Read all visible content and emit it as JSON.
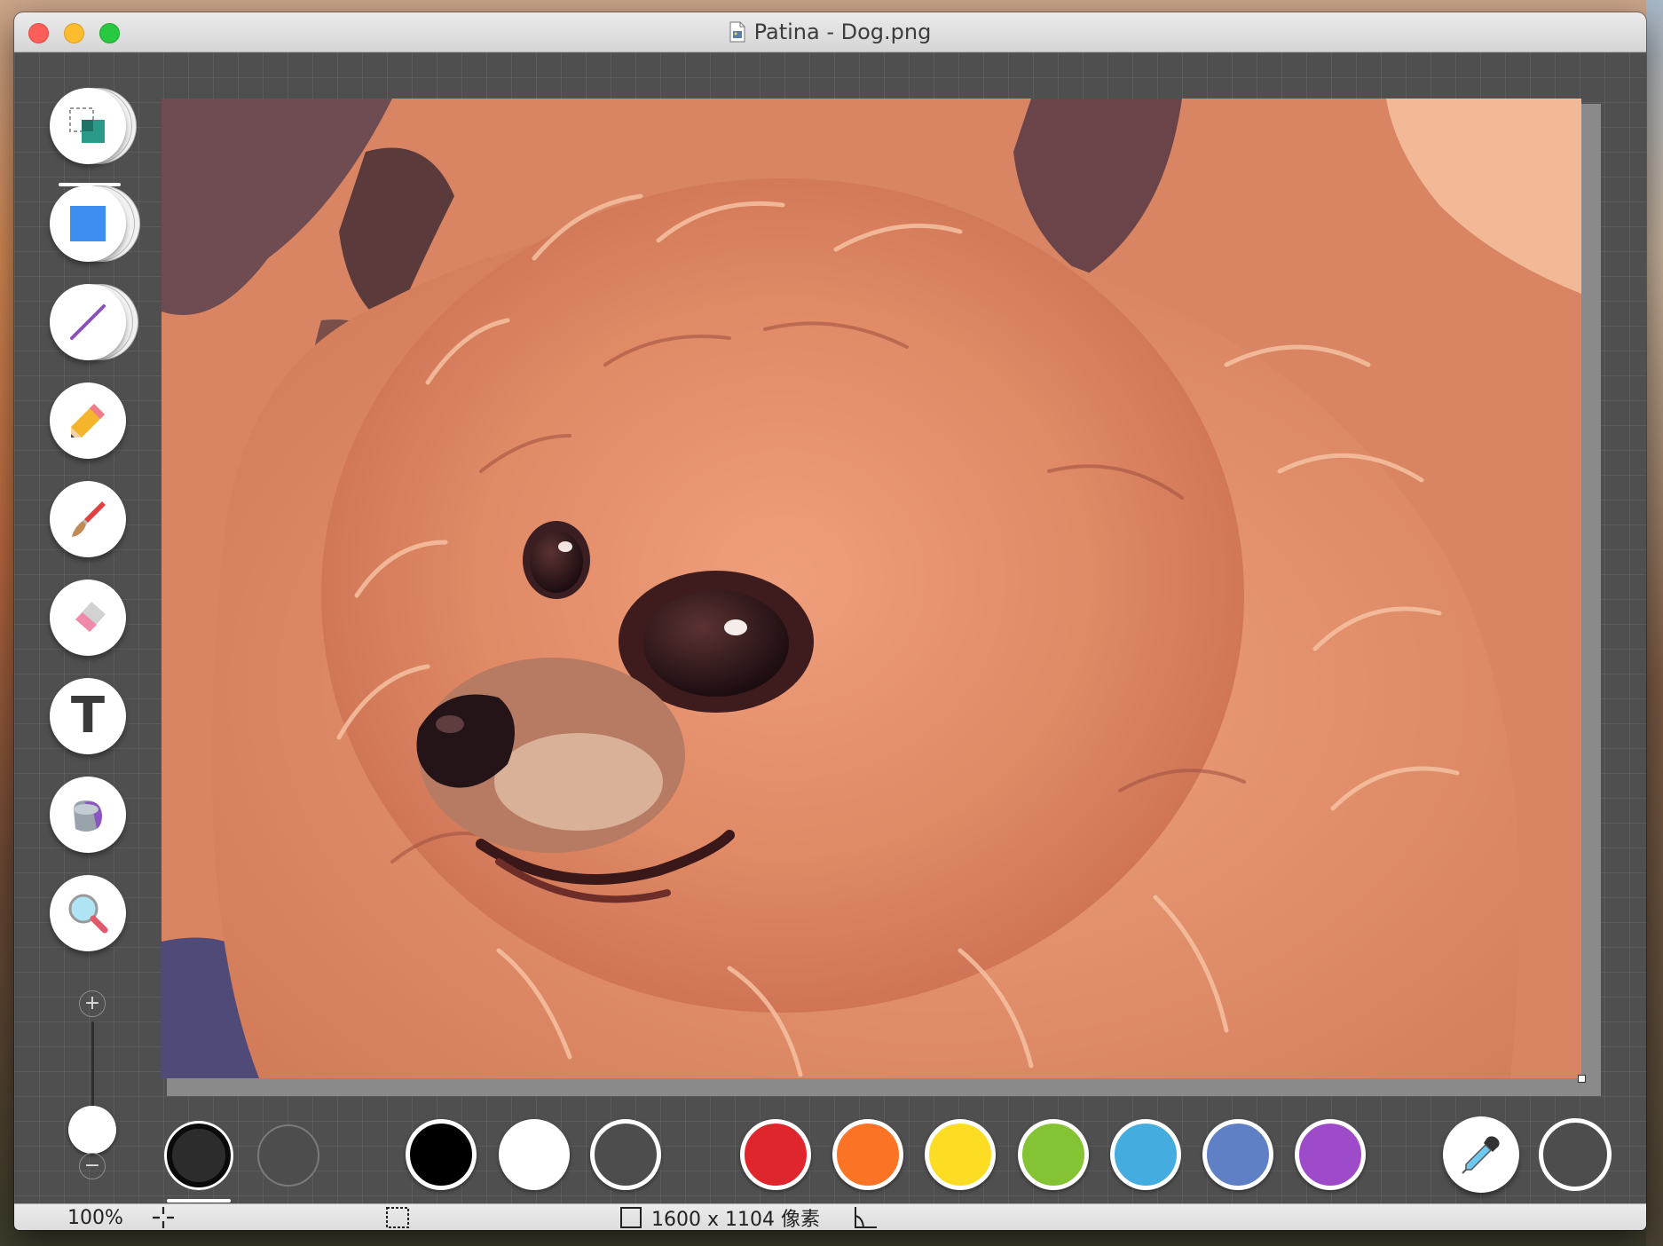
{
  "window": {
    "title": "Patina - Dog.png",
    "file_icon": "document-icon"
  },
  "toolbar": {
    "tools": [
      {
        "id": "select",
        "icon": "selection-icon"
      },
      {
        "id": "shape",
        "icon": "square-shape-icon"
      },
      {
        "id": "line",
        "icon": "line-icon"
      },
      {
        "id": "pencil",
        "icon": "pencil-icon"
      },
      {
        "id": "brush",
        "icon": "brush-icon"
      },
      {
        "id": "eraser",
        "icon": "eraser-icon"
      },
      {
        "id": "text",
        "icon": "text-icon",
        "label": "T"
      },
      {
        "id": "fill",
        "icon": "paint-bucket-icon"
      },
      {
        "id": "magnifier",
        "icon": "magnifier-icon"
      }
    ],
    "selected_tool": "select",
    "zoom_plus": "+",
    "zoom_minus": "−",
    "zoom_slider_level": 0.15
  },
  "palette": {
    "colors": [
      "#000000",
      "#ffffff",
      "none",
      "#e0262d",
      "#fb7325",
      "#fddd24",
      "#84c434",
      "#45acdf",
      "#6080c6",
      "#9e4bc9"
    ],
    "stroke_color": "#000000",
    "fill_color": "none",
    "eyedropper_icon": "eyedropper-icon"
  },
  "statusbar": {
    "zoom": "100%",
    "dimensions": "1600 x 1104 像素",
    "crosshair_icon": "crosshair-icon",
    "selection_icon": "marquee-icon",
    "size_icon": "square-outline-icon",
    "angle_icon": "angle-icon"
  }
}
